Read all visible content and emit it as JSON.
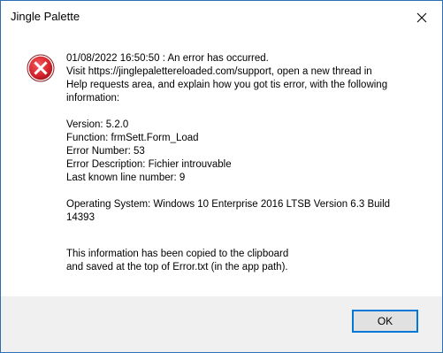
{
  "window": {
    "title": "Jingle Palette"
  },
  "icons": {
    "close": "close-icon",
    "error": "error-icon"
  },
  "colors": {
    "error_red": "#d9262e",
    "border_blue": "#2e6fb4",
    "button_focus": "#0078d7"
  },
  "message": {
    "line1": "01/08/2022 16:50:50 : An error has occurred.",
    "line2": "Visit https://jinglepalettereloaded.com/support, open a new thread in",
    "line3": "Help requests area, and explain how you got tis error, with the following",
    "line4": "information:",
    "version": "Version: 5.2.0",
    "function": "Function: frmSett.Form_Load",
    "error_number": "Error Number: 53",
    "error_description": "Error Description: Fichier introuvable",
    "last_line": "Last known line number: 9",
    "os_line1": "Operating System: Windows 10 Enterprise 2016 LTSB Version 6.3 Build",
    "os_line2": "14393",
    "clipboard_line1": "This information has been copied to the clipboard",
    "clipboard_line2": "and saved at the top of Error.txt (in the app path)."
  },
  "buttons": {
    "ok": "OK"
  }
}
